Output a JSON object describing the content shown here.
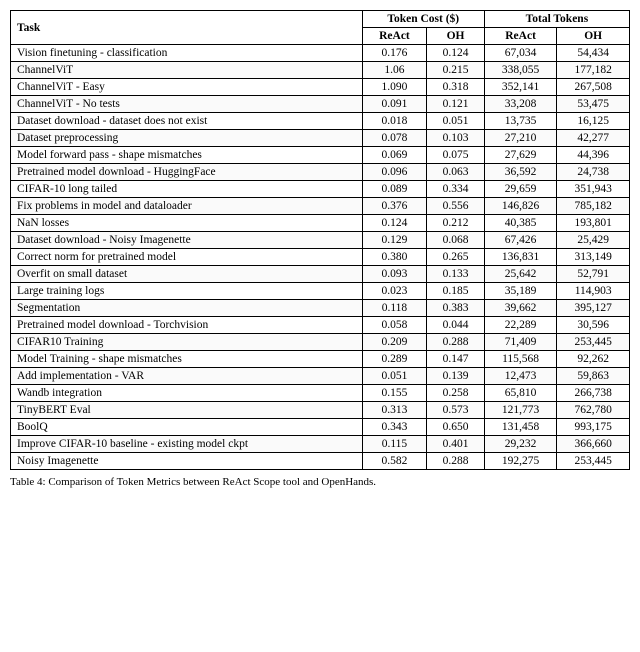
{
  "table": {
    "caption": "Table 4: Comparison of Token Metrics between ReAct Scope tool and OpenHands.",
    "headers": {
      "col1": "Task",
      "group1": "Token Cost ($)",
      "group2": "Total Tokens",
      "sub1": "ReAct",
      "sub2": "OH",
      "sub3": "ReAct",
      "sub4": "OH"
    },
    "rows": [
      {
        "task": "Vision finetuning - classification",
        "react_cost": "0.176",
        "oh_cost": "0.124",
        "react_tok": "67,034",
        "oh_tok": "54,434"
      },
      {
        "task": "ChannelViT",
        "react_cost": "1.06",
        "oh_cost": "0.215",
        "react_tok": "338,055",
        "oh_tok": "177,182"
      },
      {
        "task": "ChannelViT - Easy",
        "react_cost": "1.090",
        "oh_cost": "0.318",
        "react_tok": "352,141",
        "oh_tok": "267,508"
      },
      {
        "task": "ChannelViT - No tests",
        "react_cost": "0.091",
        "oh_cost": "0.121",
        "react_tok": "33,208",
        "oh_tok": "53,475"
      },
      {
        "task": "Dataset download - dataset does not exist",
        "react_cost": "0.018",
        "oh_cost": "0.051",
        "react_tok": "13,735",
        "oh_tok": "16,125"
      },
      {
        "task": "Dataset preprocessing",
        "react_cost": "0.078",
        "oh_cost": "0.103",
        "react_tok": "27,210",
        "oh_tok": "42,277"
      },
      {
        "task": "Model forward pass - shape mismatches",
        "react_cost": "0.069",
        "oh_cost": "0.075",
        "react_tok": "27,629",
        "oh_tok": "44,396"
      },
      {
        "task": "Pretrained model download - HuggingFace",
        "react_cost": "0.096",
        "oh_cost": "0.063",
        "react_tok": "36,592",
        "oh_tok": "24,738"
      },
      {
        "task": "CIFAR-10 long tailed",
        "react_cost": "0.089",
        "oh_cost": "0.334",
        "react_tok": "29,659",
        "oh_tok": "351,943"
      },
      {
        "task": "Fix problems in model and dataloader",
        "react_cost": "0.376",
        "oh_cost": "0.556",
        "react_tok": "146,826",
        "oh_tok": "785,182"
      },
      {
        "task": "NaN losses",
        "react_cost": "0.124",
        "oh_cost": "0.212",
        "react_tok": "40,385",
        "oh_tok": "193,801"
      },
      {
        "task": "Dataset download - Noisy Imagenette",
        "react_cost": "0.129",
        "oh_cost": "0.068",
        "react_tok": "67,426",
        "oh_tok": "25,429"
      },
      {
        "task": "Correct norm for pretrained model",
        "react_cost": "0.380",
        "oh_cost": "0.265",
        "react_tok": "136,831",
        "oh_tok": "313,149"
      },
      {
        "task": "Overfit on small dataset",
        "react_cost": "0.093",
        "oh_cost": "0.133",
        "react_tok": "25,642",
        "oh_tok": "52,791"
      },
      {
        "task": "Large training logs",
        "react_cost": "0.023",
        "oh_cost": "0.185",
        "react_tok": "35,189",
        "oh_tok": "114,903"
      },
      {
        "task": "Segmentation",
        "react_cost": "0.118",
        "oh_cost": "0.383",
        "react_tok": "39,662",
        "oh_tok": "395,127"
      },
      {
        "task": "Pretrained model download - Torchvision",
        "react_cost": "0.058",
        "oh_cost": "0.044",
        "react_tok": "22,289",
        "oh_tok": "30,596"
      },
      {
        "task": "CIFAR10 Training",
        "react_cost": "0.209",
        "oh_cost": "0.288",
        "react_tok": "71,409",
        "oh_tok": "253,445"
      },
      {
        "task": "Model Training - shape mismatches",
        "react_cost": "0.289",
        "oh_cost": "0.147",
        "react_tok": "115,568",
        "oh_tok": "92,262"
      },
      {
        "task": "Add implementation - VAR",
        "react_cost": "0.051",
        "oh_cost": "0.139",
        "react_tok": "12,473",
        "oh_tok": "59,863"
      },
      {
        "task": "Wandb integration",
        "react_cost": "0.155",
        "oh_cost": "0.258",
        "react_tok": "65,810",
        "oh_tok": "266,738"
      },
      {
        "task": "TinyBERT Eval",
        "react_cost": "0.313",
        "oh_cost": "0.573",
        "react_tok": "121,773",
        "oh_tok": "762,780"
      },
      {
        "task": "BoolQ",
        "react_cost": "0.343",
        "oh_cost": "0.650",
        "react_tok": "131,458",
        "oh_tok": "993,175"
      },
      {
        "task": "Improve CIFAR-10 baseline - existing model ckpt",
        "react_cost": "0.115",
        "oh_cost": "0.401",
        "react_tok": "29,232",
        "oh_tok": "366,660"
      },
      {
        "task": "Noisy Imagenette",
        "react_cost": "0.582",
        "oh_cost": "0.288",
        "react_tok": "192,275",
        "oh_tok": "253,445"
      }
    ]
  }
}
